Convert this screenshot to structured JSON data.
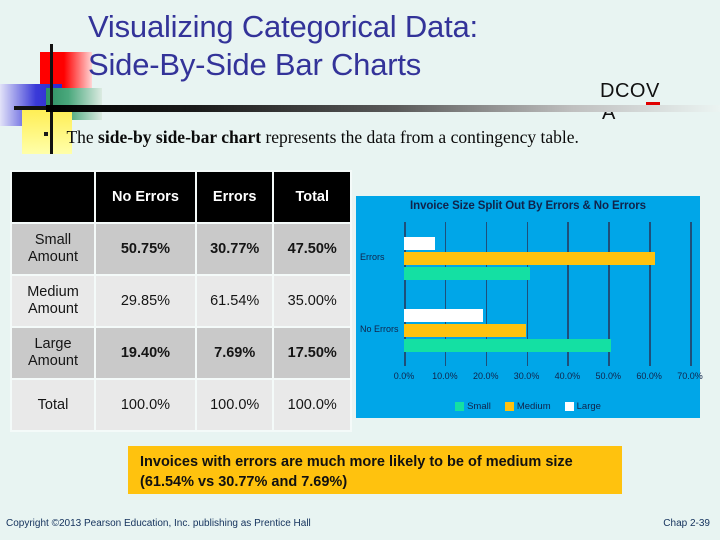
{
  "slide": {
    "title_line1": "Visualizing Categorical Data:",
    "title_line2": "Side-By-Side Bar Charts",
    "title_color": "#333399",
    "background_color": "#e8f4f2"
  },
  "watermark": {
    "prefix": "DCO",
    "highlight_letter": "V",
    "trailing_letter": "A",
    "underline_color": "#e00000"
  },
  "bullet": {
    "prefix": "The ",
    "emphasis": "side-by side-bar chart",
    "suffix": " represents the data from a contingency table."
  },
  "table": {
    "corner_header": "",
    "columns": [
      "No Errors",
      "Errors",
      "Total"
    ],
    "rows": [
      {
        "label": "Small Amount",
        "values": [
          "50.75%",
          "30.77%",
          "47.50%"
        ]
      },
      {
        "label": "Medium Amount",
        "values": [
          "29.85%",
          "61.54%",
          "35.00%"
        ]
      },
      {
        "label": "Large Amount",
        "values": [
          "19.40%",
          "7.69%",
          "17.50%"
        ]
      },
      {
        "label": "Total",
        "values": [
          "100.0%",
          "100.0%",
          "100.0%"
        ]
      }
    ]
  },
  "chart_data": {
    "type": "bar",
    "orientation": "horizontal",
    "title": "Invoice Size Split Out By Errors & No Errors",
    "xlabel": "",
    "ylabel": "",
    "categories": [
      "Errors",
      "No Errors"
    ],
    "series": [
      {
        "name": "Small",
        "color": "#14e0a3",
        "values": [
          30.77,
          50.75
        ]
      },
      {
        "name": "Medium",
        "color": "#ffc20e",
        "values": [
          61.54,
          29.85
        ]
      },
      {
        "name": "Large",
        "color": "#ffffff",
        "values": [
          7.69,
          19.4
        ]
      }
    ],
    "xlim": [
      0,
      70
    ],
    "xticks": [
      "0.0%",
      "10.0%",
      "20.0%",
      "30.0%",
      "40.0%",
      "50.0%",
      "60.0%",
      "70.0%"
    ],
    "xtick_values": [
      0,
      10,
      20,
      30,
      40,
      50,
      60,
      70
    ],
    "grid": true,
    "legend_position": "bottom",
    "plot_background": "#00a6e8",
    "axis_color": "#1e4f7a"
  },
  "callout": {
    "text": "Invoices with errors are much more likely to be of medium size (61.54% vs 30.77% and 7.69%)",
    "background_color": "#ffc20e"
  },
  "footer": {
    "copyright": "Copyright ©2013 Pearson Education, Inc. publishing as Prentice Hall",
    "chapter": "Chap 2-39"
  }
}
